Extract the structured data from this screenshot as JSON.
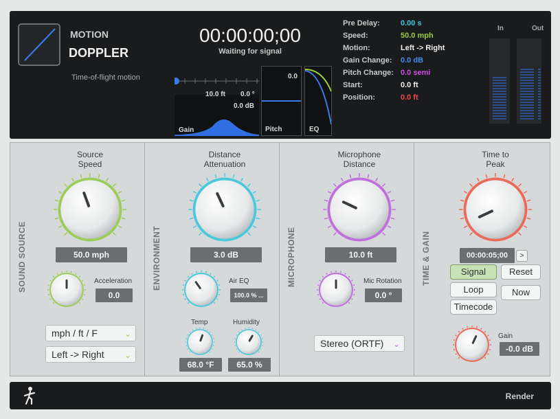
{
  "header": {
    "brand_line1": "MOTION",
    "brand_line2": "DOPPLER",
    "description": "Time-of-flight motion",
    "timecode": "00:00:00;00",
    "status": "Waiting for signal"
  },
  "graph": {
    "distance": "10.0 ft",
    "angle": "0.0 °",
    "gain": "0.0 dB",
    "gain_label": "Gain",
    "pitch_value": "0.0",
    "pitch_label": "Pitch",
    "eq_label": "EQ"
  },
  "params": [
    {
      "key": "Pre Delay:",
      "value": "0.00 s",
      "color": "#3cc8d8"
    },
    {
      "key": "Speed:",
      "value": "50.0 mph",
      "color": "#9ccc3c"
    },
    {
      "key": "Motion:",
      "value": "Left -> Right",
      "color": "#f0f0f0"
    },
    {
      "key": "Gain Change:",
      "value": "0.0 dB",
      "color": "#3c8cf0"
    },
    {
      "key": "Pitch Change:",
      "value": "0.0 semi",
      "color": "#c84ce0"
    },
    {
      "key": "Start:",
      "value": "0.0 ft",
      "color": "#f0f0f0"
    },
    {
      "key": "Position:",
      "value": "0.0 ft",
      "color": "#f04848"
    }
  ],
  "meters": {
    "in_label": "In",
    "out_label": "Out"
  },
  "sound_source": {
    "section_title": "SOUND SOURCE",
    "knob_title_1": "Source",
    "knob_title_2": "Speed",
    "speed_value": "50.0 mph",
    "accel_label": "Acceleration",
    "accel_value": "0.0",
    "units_select": "mph / ft / F",
    "direction_select": "Left -> Right",
    "color": "#9ccc5a"
  },
  "environment": {
    "section_title": "ENVIRONMENT",
    "knob_title_1": "Distance",
    "knob_title_2": "Attenuation",
    "atten_value": "3.0 dB",
    "air_eq_label": "Air EQ",
    "air_eq_value": "100.0 % ...",
    "temp_label": "Temp",
    "temp_value": "68.0 °F",
    "humidity_label": "Humidity",
    "humidity_value": "65.0 %",
    "color": "#4cc8dc"
  },
  "microphone": {
    "section_title": "MICROPHONE",
    "knob_title_1": "Microphone",
    "knob_title_2": "Distance",
    "distance_value": "10.0 ft",
    "rotation_label": "Mic Rotation",
    "rotation_value": "0.0 °",
    "mode_select": "Stereo (ORTF)",
    "color": "#c070dc"
  },
  "time_gain": {
    "section_title": "TIME & GAIN",
    "knob_title_1": "Time to",
    "knob_title_2": "Peak",
    "time_value": "00:00:05;00",
    "next_label": ">",
    "signal_label": "Signal",
    "reset_label": "Reset",
    "loop_label": "Loop",
    "now_label": "Now",
    "timecode_label": "Timecode",
    "gain_label": "Gain",
    "gain_value": "-0.0 dB",
    "color": "#ec6a5a"
  },
  "footer": {
    "render_label": "Render"
  }
}
